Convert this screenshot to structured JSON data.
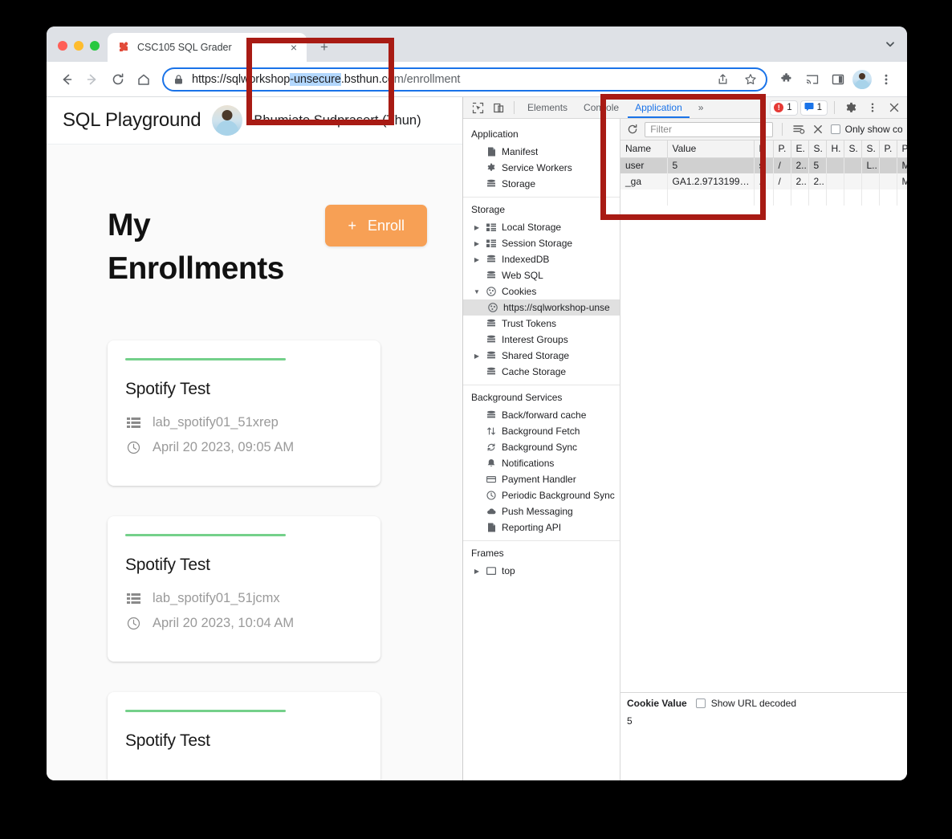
{
  "browser": {
    "tab": {
      "title": "CSC105 SQL Grader",
      "favicon": "bookmark-icon",
      "close_label": "×"
    },
    "new_tab_label": "+",
    "tabstrip_chevron": "chevron-down-icon",
    "nav": {
      "back": "←",
      "forward": "→",
      "reload": "⟳",
      "home": "⌂"
    },
    "omnibox": {
      "lock": "lock-icon",
      "scheme": "https://sqlw",
      "pre": "orkshop",
      "selected": "-unsecure",
      "post": ".bsthun.c",
      "tail": "om/enrollment",
      "full_url": "https://sqlworkshop-unsecure.bsthun.com/enrollment",
      "share": "share-icon",
      "bookmark": "star-icon"
    },
    "toolbar_icons": [
      "extensions-icon",
      "cast-icon",
      "side-panel-icon",
      "profile-avatar",
      "menu-kebab-icon"
    ]
  },
  "page": {
    "brand": "SQL Playground",
    "user_name": "Bhumiate Sudprasert (Thun)",
    "title": "My Enrollments",
    "enroll_button": {
      "plus": "+",
      "label": "Enroll"
    },
    "cards": [
      {
        "title": "Spotify Test",
        "lab_id": "lab_spotify01_51xrep",
        "timestamp": "April 20 2023, 09:05 AM"
      },
      {
        "title": "Spotify Test",
        "lab_id": "lab_spotify01_51jcmx",
        "timestamp": "April 20 2023, 10:04 AM"
      },
      {
        "title": "Spotify Test",
        "lab_id": "",
        "timestamp": ""
      }
    ]
  },
  "devtools": {
    "top_tabs": [
      {
        "label": "Elements",
        "active": false
      },
      {
        "label": "Console",
        "active": false
      },
      {
        "label": "Application",
        "active": true
      }
    ],
    "more_tabs": "»",
    "errors_badge": "1",
    "messages_badge": "1",
    "settings_icon": "gear-icon",
    "kebab_icon": "menu-kebab-icon",
    "close_icon": "close-icon",
    "inspect_icon": "inspect-element-icon",
    "device_icon": "device-toolbar-icon",
    "sidebar": {
      "groups": [
        {
          "title": "Application",
          "items": [
            {
              "label": "Manifest",
              "icon": "document-icon",
              "arrow": false,
              "selected": false
            },
            {
              "label": "Service Workers",
              "icon": "gear-icon",
              "arrow": false,
              "selected": false
            },
            {
              "label": "Storage",
              "icon": "database-icon",
              "arrow": false,
              "selected": false
            }
          ]
        },
        {
          "title": "Storage",
          "items": [
            {
              "label": "Local Storage",
              "icon": "table-icon",
              "arrow": true,
              "selected": false
            },
            {
              "label": "Session Storage",
              "icon": "table-icon",
              "arrow": true,
              "selected": false
            },
            {
              "label": "IndexedDB",
              "icon": "database-icon",
              "arrow": true,
              "selected": false
            },
            {
              "label": "Web SQL",
              "icon": "database-icon",
              "arrow": false,
              "selected": false
            },
            {
              "label": "Cookies",
              "icon": "cookie-icon",
              "arrow": true,
              "expanded": true,
              "selected": false
            },
            {
              "label": "https://sqlworkshop-unse",
              "icon": "cookie-icon",
              "arrow": false,
              "selected": true,
              "indent": true
            },
            {
              "label": "Trust Tokens",
              "icon": "database-icon",
              "arrow": false,
              "selected": false
            },
            {
              "label": "Interest Groups",
              "icon": "database-icon",
              "arrow": false,
              "selected": false
            },
            {
              "label": "Shared Storage",
              "icon": "database-icon",
              "arrow": true,
              "selected": false
            },
            {
              "label": "Cache Storage",
              "icon": "database-icon",
              "arrow": false,
              "selected": false
            }
          ]
        },
        {
          "title": "Background Services",
          "items": [
            {
              "label": "Back/forward cache",
              "icon": "database-icon",
              "arrow": false,
              "selected": false
            },
            {
              "label": "Background Fetch",
              "icon": "updown-arrows-icon",
              "arrow": false,
              "selected": false
            },
            {
              "label": "Background Sync",
              "icon": "sync-icon",
              "arrow": false,
              "selected": false
            },
            {
              "label": "Notifications",
              "icon": "bell-icon",
              "arrow": false,
              "selected": false
            },
            {
              "label": "Payment Handler",
              "icon": "card-icon",
              "arrow": false,
              "selected": false
            },
            {
              "label": "Periodic Background Sync",
              "icon": "clock-icon",
              "arrow": false,
              "selected": false
            },
            {
              "label": "Push Messaging",
              "icon": "cloud-icon",
              "arrow": false,
              "selected": false
            },
            {
              "label": "Reporting API",
              "icon": "document-icon",
              "arrow": false,
              "selected": false
            }
          ]
        },
        {
          "title": "Frames",
          "items": [
            {
              "label": "top",
              "icon": "frame-icon",
              "arrow": true,
              "selected": false
            }
          ]
        }
      ]
    },
    "cookie_toolbar": {
      "refresh_icon": "refresh-icon",
      "filter_placeholder": "Filter",
      "clear_filtered_icon": "clear-filtered-icon",
      "clear_all_icon": "close-icon",
      "only_show_label": "Only show cooki…"
    },
    "cookie_table": {
      "columns": [
        "Name",
        "Value",
        "D",
        "P.",
        "E.",
        "S.",
        "H.",
        "S.",
        "S.",
        "P.",
        "P"
      ],
      "rows": [
        {
          "selected": true,
          "cells": [
            "user",
            "5",
            "s.",
            "/",
            "2..",
            "5",
            "",
            "",
            "L..",
            "",
            "M."
          ]
        },
        {
          "selected": false,
          "cells": [
            "_ga",
            "GA1.2.9713199…",
            "..",
            "/",
            "2..",
            "2..",
            "",
            "",
            "",
            "",
            "M."
          ]
        }
      ]
    },
    "cookie_value_pane": {
      "title": "Cookie Value",
      "show_url_decoded_label": "Show URL decoded",
      "value": "5"
    }
  },
  "annotations": {
    "rect_1_target": "url-unsecure-highlight",
    "rect_2_target": "cookie-table-highlight",
    "color": "#a81b14"
  }
}
